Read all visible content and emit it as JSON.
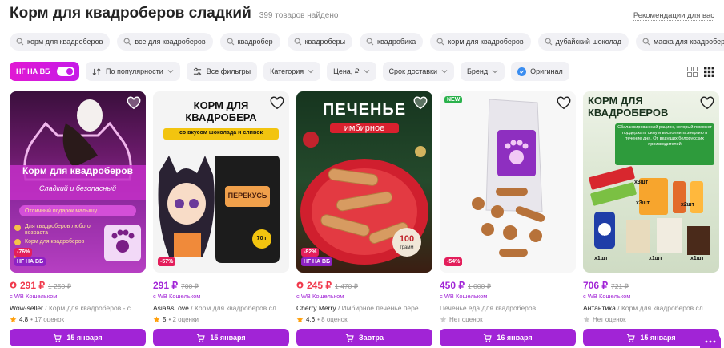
{
  "header": {
    "title": "Корм для квадроберов сладкий",
    "count": "399 товаров найдено",
    "recs_link": "Рекомендации для вас"
  },
  "chips": [
    "корм для квадроберов",
    "все для квадроберов",
    "квадробер",
    "квадроберы",
    "квадробика",
    "корм для квадроберов",
    "дубайский шоколад",
    "маска для квадробера"
  ],
  "filters": {
    "ng_toggle": "НГ НА ВБ",
    "sort": "По популярности",
    "all_filters": "Все фильтры",
    "category": "Категория",
    "price": "Цена, ₽",
    "delivery": "Срок доставки",
    "brand": "Бренд",
    "original": "Оригинал"
  },
  "products": [
    {
      "price": "291 ₽",
      "old_price": "1 250 ₽",
      "wallet": "с WB Кошельком",
      "seller": "Wow-seller",
      "name": " / Корм для квадроберов - с...",
      "rating": "4,8",
      "reviews": "• 17 оценок",
      "delivery": "15 января",
      "discount": "-76%",
      "ng": "НГ НА ВБ",
      "new": "",
      "thumb": {
        "title": "Корм для квадроберов",
        "subtitle": "Сладкий и безопасный",
        "lines": [
          "Отличный подарок малышу",
          "Для квадроберов любого возраста",
          "Корм для квадроберов"
        ]
      }
    },
    {
      "price": "291 ₽",
      "old_price": "700 ₽",
      "wallet": "с WB Кошельком",
      "seller": "AsiaAsLove",
      "name": " / Корм для квадроберов сл...",
      "rating": "5",
      "reviews": "• 2 оценки",
      "delivery": "15 января",
      "discount": "-57%",
      "ng": "",
      "new": "",
      "thumb": {
        "title": "КОРМ ДЛЯ КВАДРОБЕРА",
        "subtitle": "со вкусом шоколада и сливок",
        "lines": [
          "ПЕРЕКУСЬ",
          "70 г"
        ]
      }
    },
    {
      "price": "245 ₽",
      "old_price": "1 470 ₽",
      "wallet": "с WB Кошельком",
      "seller": "Cherry Merry",
      "name": " / Имбирное печенье пере...",
      "rating": "4,6",
      "reviews": "• 8 оценок",
      "delivery": "Завтра",
      "discount": "-82%",
      "ng": "НГ НА ВБ",
      "new": "",
      "thumb": {
        "title": "ПЕЧЕНЬЕ",
        "subtitle": "имбирное",
        "lines": [
          "100",
          "грамм"
        ]
      }
    },
    {
      "price": "450 ₽",
      "old_price": "1 000 ₽",
      "wallet": "с WB Кошельком",
      "seller": "",
      "name": "Печенье еда для квадроберов",
      "rating": "",
      "reviews": "Нет оценок",
      "delivery": "16 января",
      "discount": "-54%",
      "ng": "",
      "new": "NEW",
      "thumb": {
        "title": "",
        "subtitle": "",
        "lines": []
      }
    },
    {
      "price": "706 ₽",
      "old_price": "721 ₽",
      "wallet": "с WB Кошельком",
      "seller": "Антантика",
      "name": " / Корм для квадроберов сл...",
      "rating": "",
      "reviews": "Нет оценок",
      "delivery": "15 января",
      "discount": "",
      "ng": "",
      "new": "",
      "thumb": {
        "title": "КОРМ ДЛЯ КВАДРОБЕРОВ",
        "subtitle": "Сбалансированный рацион, который поможет поддержать силу и восполнить энергию в течение дня. От ведущих белорусских производителей",
        "lines": [
          "х3шт",
          "х3шт",
          "х2шт",
          "х1шт",
          "х1шт",
          "х1шт",
          "PEPSI"
        ]
      }
    }
  ],
  "colors": {
    "accent": "#a124d6",
    "price_red": "#f0384b",
    "discount": "#e31e5b",
    "ng_gradient": "#e119d3"
  }
}
